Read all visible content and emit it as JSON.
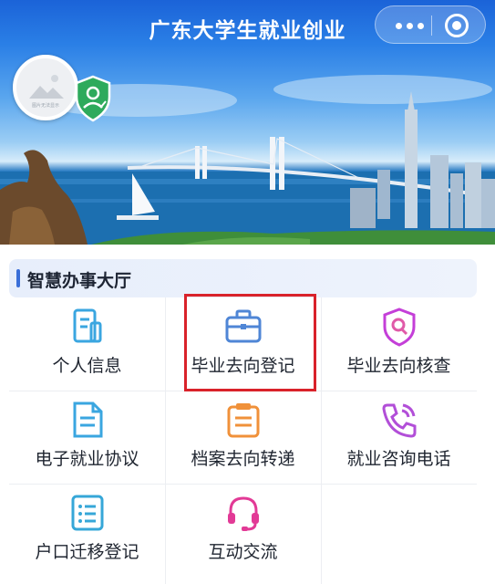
{
  "header": {
    "title": "广东大学生就业创业",
    "menu_icon": "more-dots-icon",
    "close_icon": "target-close-icon"
  },
  "profile": {
    "avatar_caption": "图片无法显示",
    "badge_icon": "shield-person-icon"
  },
  "section": {
    "title": "智慧办事大厅"
  },
  "services": [
    {
      "label": "个人信息",
      "icon": "document-icon",
      "color": "#3aa6e0"
    },
    {
      "label": "毕业去向登记",
      "icon": "briefcase-icon",
      "color": "#4f86d6"
    },
    {
      "label": "毕业去向核查",
      "icon": "shield-search-icon",
      "color": "#c43fd8"
    },
    {
      "label": "电子就业协议",
      "icon": "file-text-icon",
      "color": "#3aa6e0"
    },
    {
      "label": "档案去向转递",
      "icon": "archive-box-icon",
      "color": "#f0913a"
    },
    {
      "label": "就业咨询电话",
      "icon": "phone-icon",
      "color": "#b24fd8"
    },
    {
      "label": "户口迁移登记",
      "icon": "list-icon",
      "color": "#36a7d8"
    },
    {
      "label": "互动交流",
      "icon": "headset-icon",
      "color": "#e23a96"
    }
  ],
  "colors": {
    "accent": "#3a6fd8",
    "highlight": "#d9222a"
  }
}
